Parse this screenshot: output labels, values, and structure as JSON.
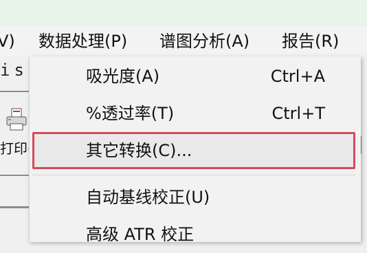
{
  "menubar": {
    "items": [
      {
        "label": "V)"
      },
      {
        "label": "数据处理(P)"
      },
      {
        "label": "谱图分析(A)"
      },
      {
        "label": "报告(R)"
      }
    ]
  },
  "left_panel": {
    "strip_text": "iss",
    "toolbar_label": "打印("
  },
  "dropdown": {
    "items": [
      {
        "label": "吸光度(A)",
        "shortcut": "Ctrl+A"
      },
      {
        "label": "%透过率(T)",
        "shortcut": "Ctrl+T"
      },
      {
        "label": "其它转换(C)...",
        "shortcut": ""
      },
      {
        "label": "自动基线校正(U)",
        "shortcut": ""
      },
      {
        "label": "高级 ATR 校正",
        "shortcut": ""
      }
    ]
  },
  "colors": {
    "titlebar": "#e6f4ea",
    "highlight_border": "#d64a5a"
  }
}
